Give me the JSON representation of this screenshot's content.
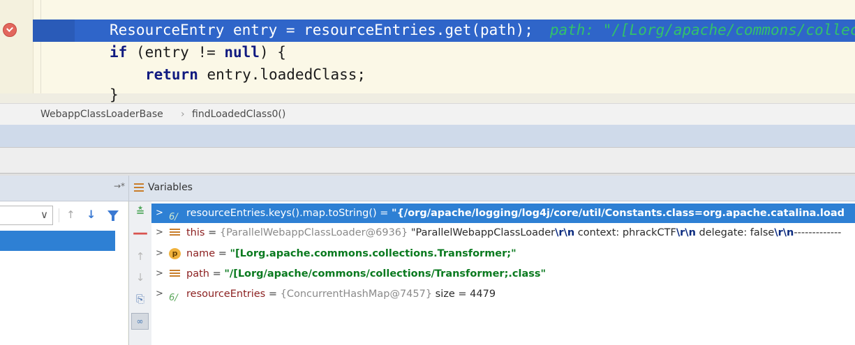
{
  "editor": {
    "line1": {
      "code": "ResourceEntry entry = resourceEntries.get(path);",
      "inline_value": "path: \"/[Lorg/apache/commons/collec"
    },
    "line2": {
      "kw_if": "if",
      "part1": " (entry != ",
      "kw_null": "null",
      "part2": ") {"
    },
    "line3": {
      "kw_return": "return",
      "rest": " entry.loadedClass;"
    },
    "line4": {
      "text": "}"
    }
  },
  "breadcrumb": {
    "class_name": "WebappClassLoaderBase",
    "separator": "›",
    "method_name": "findLoadedClass0()"
  },
  "variables_panel": {
    "title": "Variables",
    "pin_symbol": "→*"
  },
  "frames_toolbar": {
    "up_arrow": "↑",
    "down_arrow": "↓",
    "chevron": "∨"
  },
  "side_toolbar": {
    "eval": "≛",
    "remove": "—",
    "up": "↑",
    "down": "↓",
    "copy": "⎘",
    "watch": "∞"
  },
  "variables": [
    {
      "expander": ">",
      "icon": "watch-expression-icon",
      "icon_glyph": "6∕",
      "name": "resourceEntries.keys().map.toString()",
      "eq": " = ",
      "value": "\"{/org/apache/logging/log4j/core/util/Constants.class=org.apache.catalina.load"
    },
    {
      "expander": ">",
      "icon": "field-icon",
      "name": "this",
      "eq": " = ",
      "type": "{ParallelWebappClassLoader@6936}",
      "value_p1": " \"ParallelWebappClassLoader",
      "esc1": "\\r\\n",
      "value_p2": "  context: phrackCTF",
      "esc2": "\\r\\n",
      "value_p3": "  delegate: false",
      "esc3": "\\r\\n",
      "value_p4": "-------------"
    },
    {
      "expander": ">",
      "icon": "parameter-icon",
      "icon_glyph": "p",
      "name": "name",
      "eq": " = ",
      "value": "\"[Lorg.apache.commons.collections.Transformer;\""
    },
    {
      "expander": ">",
      "icon": "field-icon",
      "name": "path",
      "eq": " = ",
      "value": "\"/[Lorg/apache/commons/collections/Transformer;.class\""
    },
    {
      "expander": ">",
      "icon": "watch-expression-icon",
      "icon_glyph": "6∕",
      "name": "resourceEntries",
      "eq": " = ",
      "type": "{ConcurrentHashMap@7457}",
      "value": "  size = 4479"
    }
  ],
  "colors": {
    "execution_line": "#2f65c9",
    "selection": "#2e80d4",
    "string_value": "#0a7a1f",
    "variable_name": "#8b1f1f",
    "inline_value": "#32c26a"
  }
}
